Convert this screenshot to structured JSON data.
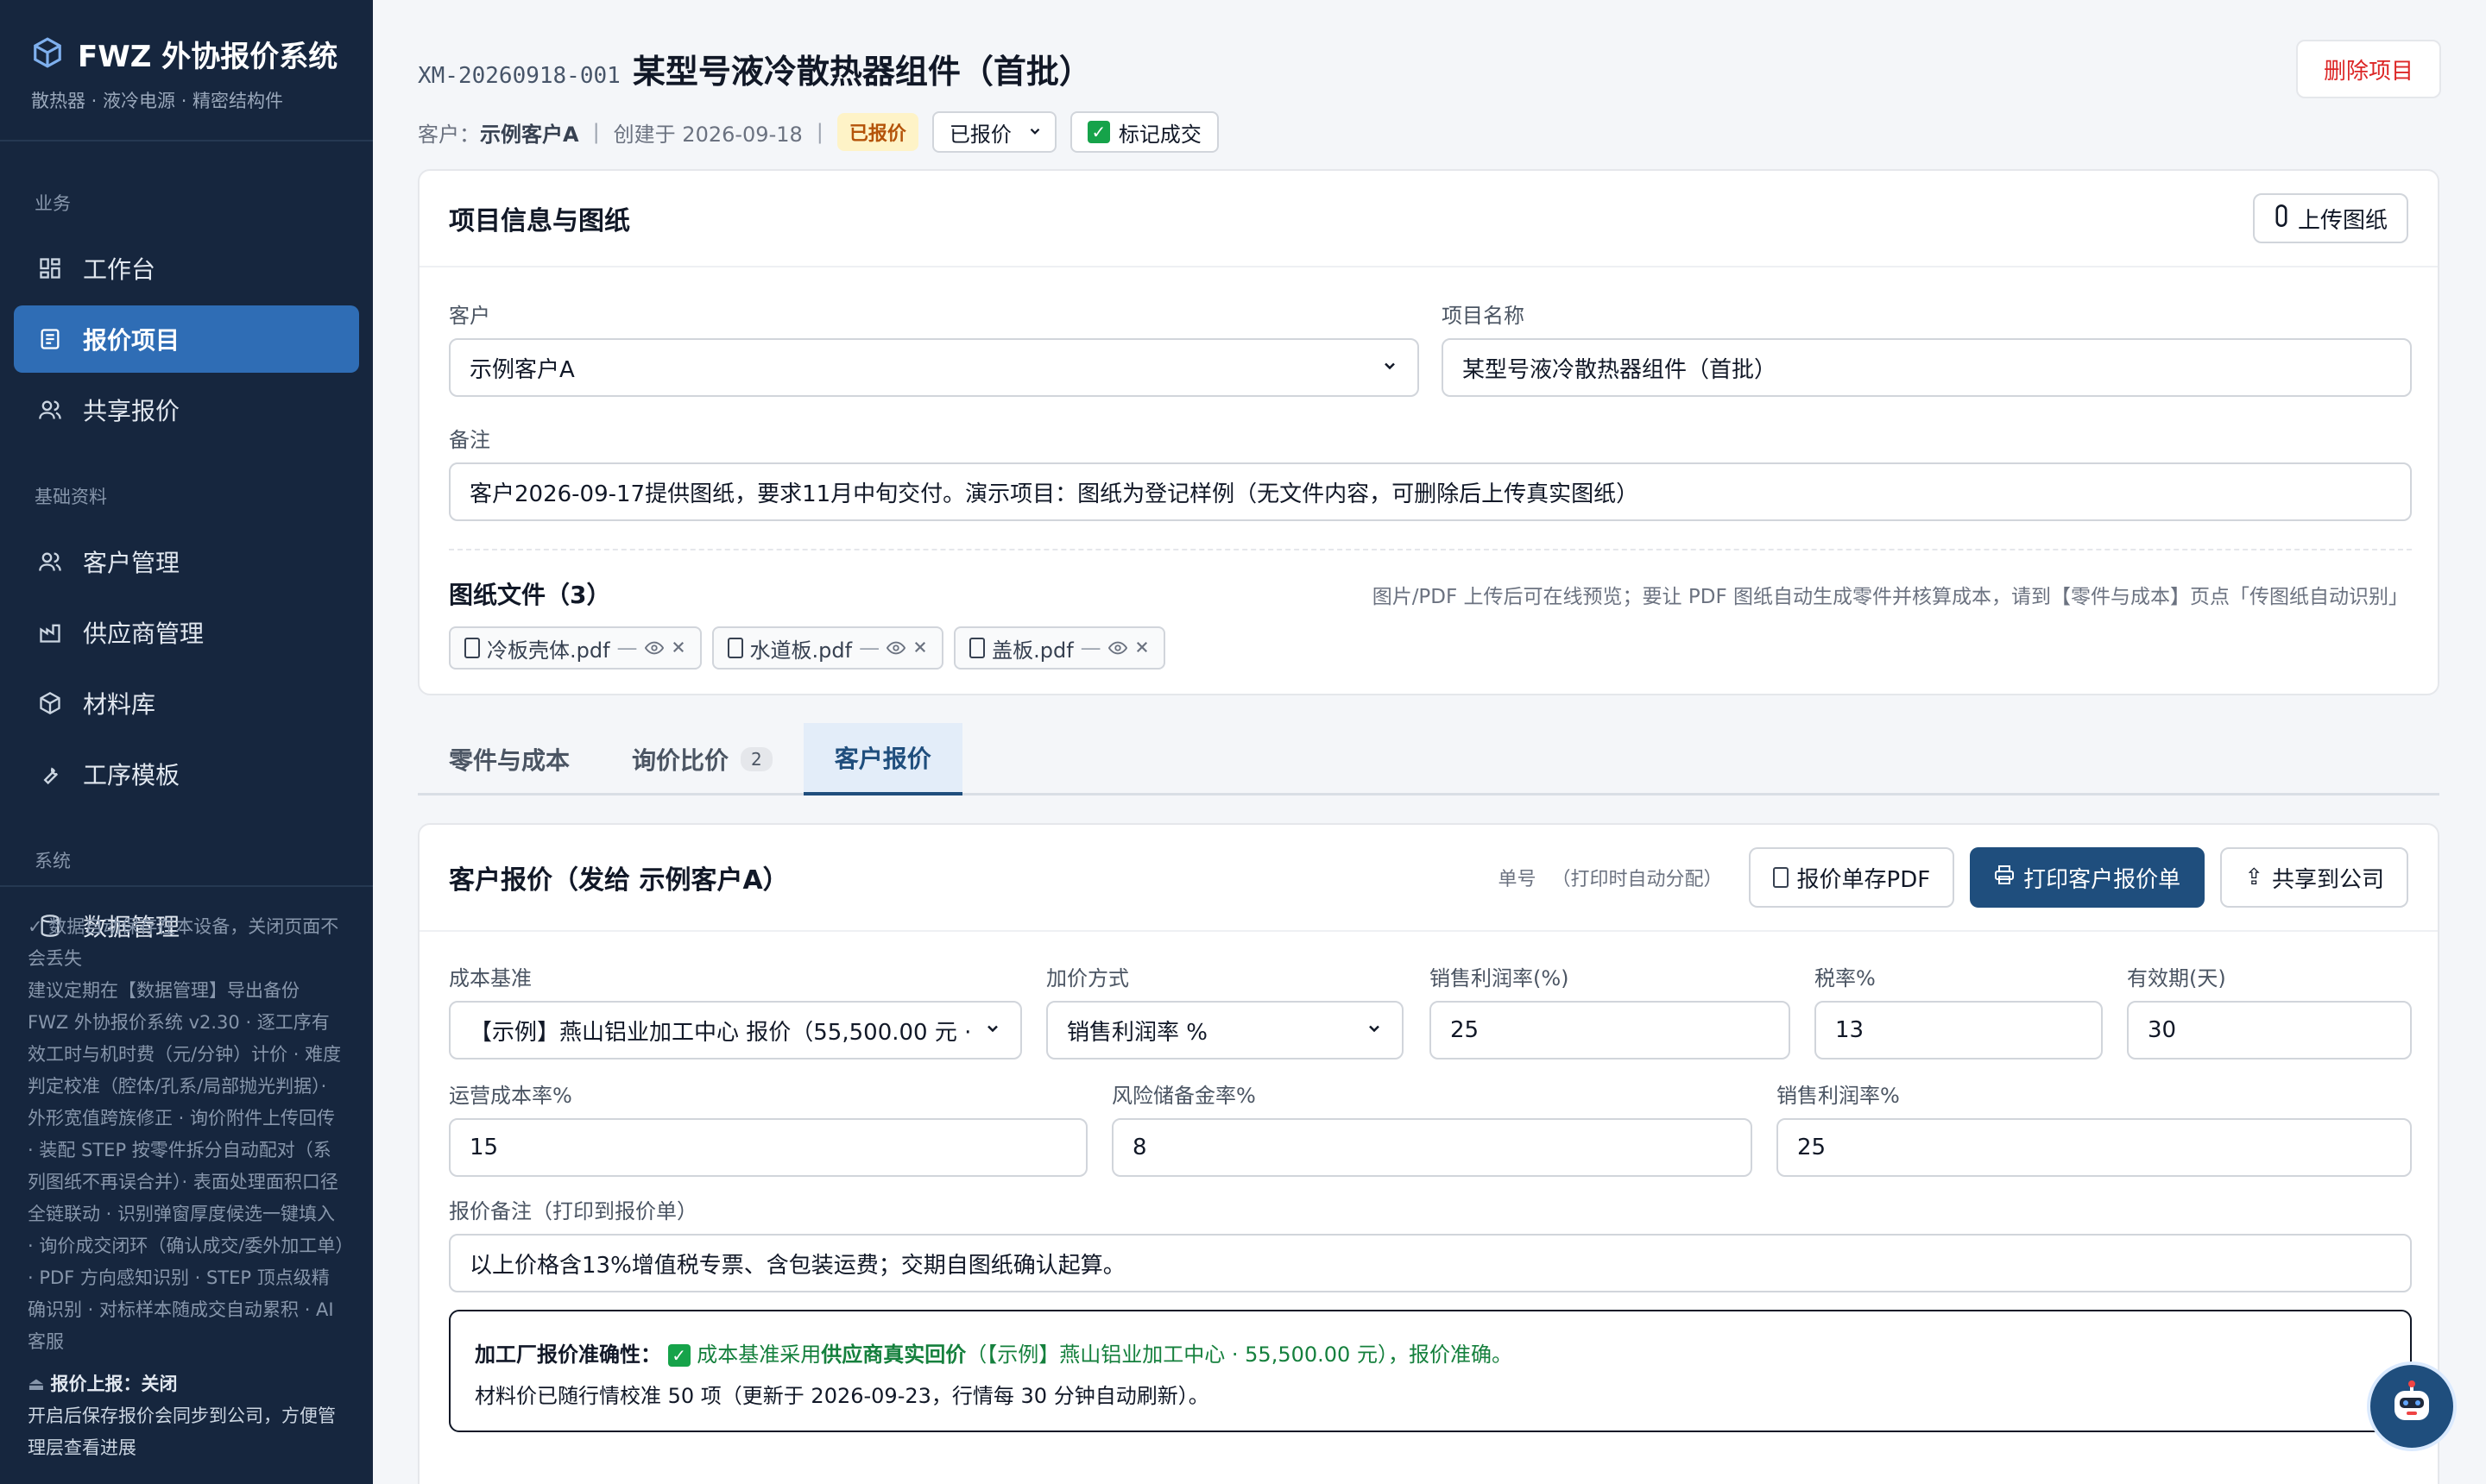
{
  "sidebar": {
    "brand_title": "FWZ 外协报价系统",
    "brand_sub": "散热器 · 液冷电源 · 精密结构件",
    "sections": [
      {
        "label": "业务",
        "items": [
          {
            "label": "工作台",
            "icon": "dashboard-icon"
          },
          {
            "label": "报价项目",
            "icon": "document-icon",
            "active": true
          },
          {
            "label": "共享报价",
            "icon": "users-icon"
          }
        ]
      },
      {
        "label": "基础资料",
        "items": [
          {
            "label": "客户管理",
            "icon": "users-icon"
          },
          {
            "label": "供应商管理",
            "icon": "factory-icon"
          },
          {
            "label": "材料库",
            "icon": "cube-icon"
          },
          {
            "label": "工序模板",
            "icon": "wrench-icon"
          }
        ]
      },
      {
        "label": "系统",
        "items": [
          {
            "label": "数据管理",
            "icon": "database-icon"
          }
        ]
      }
    ],
    "footer": {
      "autosave": "✓ 数据自动保存在本设备，关闭页面不会丢失",
      "backup": "建议定期在【数据管理】导出备份",
      "version_notes": "FWZ 外协报价系统 v2.30 · 逐工序有效工时与机时费（元/分钟）计价 · 难度判定校准（腔体/孔系/局部抛光判据）· 外形宽值跨族修正 · 询价附件上传回传 · 装配 STEP 按零件拆分自动配对（系列图纸不再误合并）· 表面处理面积口径全链联动 · 识别弹窗厚度候选一键填入 · 询价成交闭环（确认成交/委外加工单）· PDF 方向感知识别 · STEP 顶点级精确识别 · 对标样本随成交自动累积 · AI 客服",
      "sync_title": "报价上报：关闭",
      "sync_desc": "开启后保存报价会同步到公司，方便管理层查看进展"
    }
  },
  "header": {
    "project_no": "XM-20260918-001",
    "project_title": "某型号液冷散热器组件（首批）",
    "customer_label": "客户：",
    "customer_name": "示例客户A",
    "created": "创建于 2026-09-18",
    "status_badge": "已报价",
    "status_select": "已报价",
    "mark_deal": "标记成交",
    "delete_button": "删除项目"
  },
  "info_card": {
    "title": "项目信息与图纸",
    "upload_button": "上传图纸",
    "customer_label": "客户",
    "customer_value": "示例客户A",
    "project_name_label": "项目名称",
    "project_name_value": "某型号液冷散热器组件（首批）",
    "remark_label": "备注",
    "remark_value": "客户2026-09-17提供图纸，要求11月中旬交付。演示项目：图纸为登记样例（无文件内容，可删除后上传真实图纸）",
    "files_title": "图纸文件（3）",
    "files_hint": "图片/PDF 上传后可在线预览；要让 PDF 图纸自动生成零件并核算成本，请到【零件与成本】页点「传图纸自动识别」",
    "files": [
      {
        "name": "冷板壳体.pdf",
        "size": "—"
      },
      {
        "name": "水道板.pdf",
        "size": "—"
      },
      {
        "name": "盖板.pdf",
        "size": "—"
      }
    ]
  },
  "tabs": [
    {
      "label": "零件与成本",
      "count": ""
    },
    {
      "label": "询价比价",
      "count": "2"
    },
    {
      "label": "客户报价",
      "count": "",
      "active": true
    }
  ],
  "quote_card": {
    "title": "客户报价（发给 示例客户A）",
    "order_no_label": "单号",
    "order_no_value": "（打印时自动分配）",
    "save_pdf": "报价单存PDF",
    "print": "打印客户报价单",
    "share": "共享到公司",
    "cost_base_label": "成本基准",
    "cost_base_value": "【示例】燕山铝业加工中心 报价（55,500.00 元 ·",
    "markup_label": "加价方式",
    "markup_value": "销售利润率 %",
    "margin_label": "销售利润率(%)",
    "margin_value": "25",
    "tax_label": "税率%",
    "tax_value": "13",
    "validity_label": "有效期(天)",
    "validity_value": "30",
    "opex_label": "运营成本率%",
    "opex_value": "15",
    "risk_label": "风险储备金率%",
    "risk_value": "8",
    "margin2_label": "销售利润率%",
    "margin2_value": "25",
    "note_label": "报价备注（打印到报价单）",
    "note_value": "以上价格含13%增值税专票、含包装运费；交期自图纸确认起算。",
    "accuracy_label": "加工厂报价准确性：",
    "accuracy_prefix": "成本基准采用",
    "accuracy_strong": "供应商真实回价",
    "accuracy_suffix": "（【示例】燕山铝业加工中心 · 55,500.00 元），报价准确。",
    "material_note": "材料价已随行情校准 50 项（更新于 2026-09-23，行情每 30 分钟自动刷新）。"
  },
  "colors": {
    "sidebar_bg": "#16263e",
    "accent": "#2f6db5",
    "primary": "#1f4e7d",
    "danger": "#dc2626",
    "success": "#16a34a"
  }
}
